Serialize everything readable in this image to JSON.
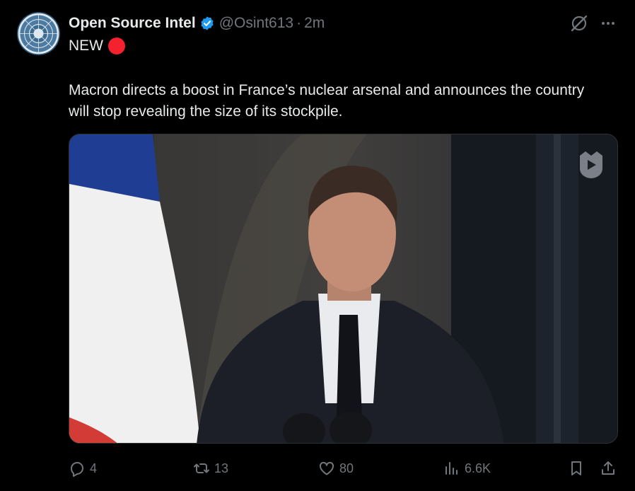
{
  "tweet": {
    "author_name": "Open Source Intel",
    "handle": "@Osint613",
    "separator": "·",
    "time": "2m",
    "line1": "NEW",
    "body": "Macron directs a boost in France’s nuclear arsenal and announces the country will stop revealing the size of its stockpile."
  },
  "icons": {
    "verified": "verified-badge-icon",
    "grok": "grok-icon",
    "more": "more-icon",
    "video": "video-play-icon",
    "reply": "reply-icon",
    "retweet": "retweet-icon",
    "like": "like-icon",
    "views": "views-icon",
    "bookmark": "bookmark-icon",
    "share": "share-icon"
  },
  "actions": {
    "replies": "4",
    "retweets": "13",
    "likes": "80",
    "views": "6.6K"
  },
  "colors": {
    "background": "#000000",
    "text": "#e7e9ea",
    "muted": "#71767b",
    "verified": "#1d9bf0",
    "red_dot": "#f4212e"
  }
}
